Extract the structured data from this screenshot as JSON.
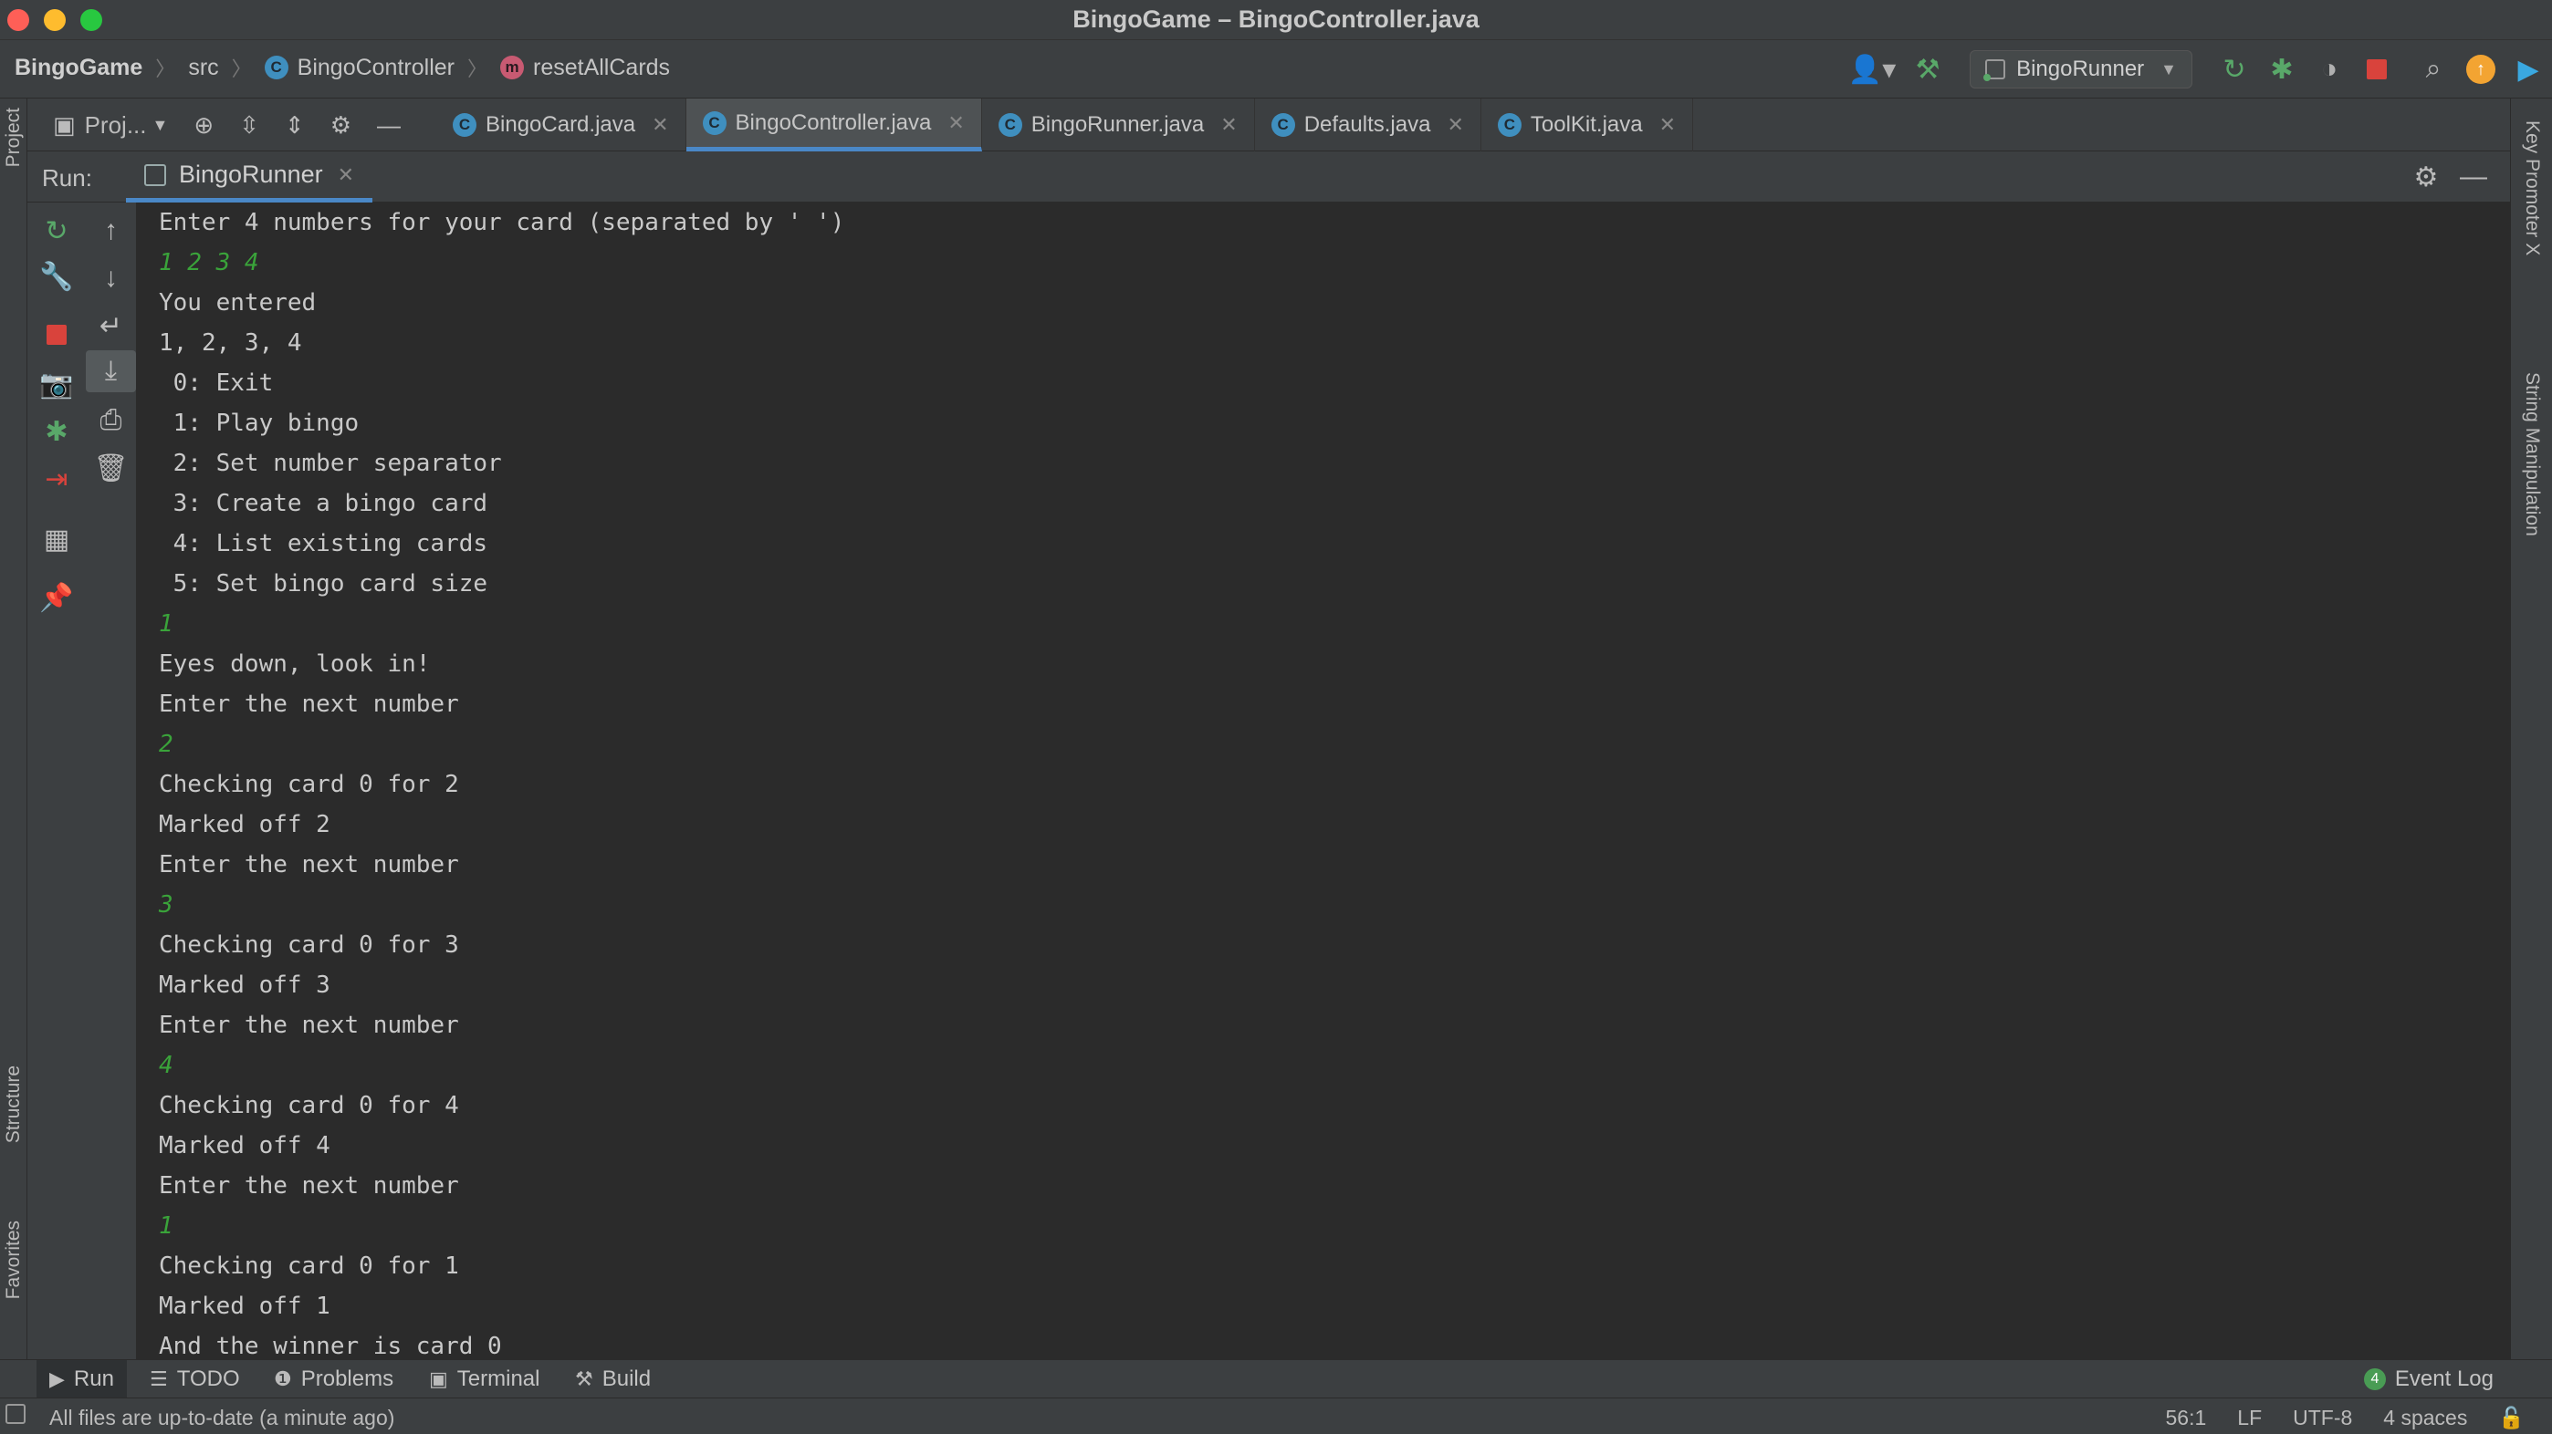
{
  "window": {
    "title": "BingoGame – BingoController.java"
  },
  "breadcrumb": {
    "project": "BingoGame",
    "src": "src",
    "class": "BingoController",
    "method": "resetAllCards"
  },
  "run_config": {
    "name": "BingoRunner"
  },
  "project_panel": {
    "label": "Proj..."
  },
  "editor_tabs": [
    {
      "label": "BingoCard.java"
    },
    {
      "label": "BingoController.java"
    },
    {
      "label": "BingoRunner.java"
    },
    {
      "label": "Defaults.java"
    },
    {
      "label": "ToolKit.java"
    }
  ],
  "run_panel": {
    "label": "Run:",
    "tab": "BingoRunner"
  },
  "console": {
    "lines": [
      {
        "text": "Enter 4 numbers for your card (separated by ' ')",
        "kind": "out"
      },
      {
        "text": "1 2 3 4",
        "kind": "in"
      },
      {
        "text": "You entered",
        "kind": "out"
      },
      {
        "text": "1, 2, 3, 4",
        "kind": "out"
      },
      {
        "text": " 0: Exit",
        "kind": "out"
      },
      {
        "text": " 1: Play bingo",
        "kind": "out"
      },
      {
        "text": " 2: Set number separator",
        "kind": "out"
      },
      {
        "text": " 3: Create a bingo card",
        "kind": "out"
      },
      {
        "text": " 4: List existing cards",
        "kind": "out"
      },
      {
        "text": " 5: Set bingo card size",
        "kind": "out"
      },
      {
        "text": "1",
        "kind": "in"
      },
      {
        "text": "Eyes down, look in!",
        "kind": "out"
      },
      {
        "text": "Enter the next number",
        "kind": "out"
      },
      {
        "text": "2",
        "kind": "in"
      },
      {
        "text": "Checking card 0 for 2",
        "kind": "out"
      },
      {
        "text": "Marked off 2",
        "kind": "out"
      },
      {
        "text": "Enter the next number",
        "kind": "out"
      },
      {
        "text": "3",
        "kind": "in"
      },
      {
        "text": "Checking card 0 for 3",
        "kind": "out"
      },
      {
        "text": "Marked off 3",
        "kind": "out"
      },
      {
        "text": "Enter the next number",
        "kind": "out"
      },
      {
        "text": "4",
        "kind": "in"
      },
      {
        "text": "Checking card 0 for 4",
        "kind": "out"
      },
      {
        "text": "Marked off 4",
        "kind": "out"
      },
      {
        "text": "Enter the next number",
        "kind": "out"
      },
      {
        "text": "1",
        "kind": "in"
      },
      {
        "text": "Checking card 0 for 1",
        "kind": "out"
      },
      {
        "text": "Marked off 1",
        "kind": "out"
      },
      {
        "text": "And the winner is card 0",
        "kind": "out"
      }
    ]
  },
  "left_stripe": {
    "project": "Project",
    "structure": "Structure",
    "favorites": "Favorites"
  },
  "right_stripe": {
    "key_promoter": "Key Promoter X",
    "string_manipulation": "String Manipulation"
  },
  "bottom_tabs": {
    "run": "Run",
    "todo": "TODO",
    "problems": "Problems",
    "terminal": "Terminal",
    "build": "Build",
    "event_log": "Event Log",
    "event_count": "4"
  },
  "status": {
    "message": "All files are up-to-date (a minute ago)",
    "position": "56:1",
    "line_sep": "LF",
    "encoding": "UTF-8",
    "indent": "4 spaces"
  },
  "colors": {
    "accent": "#4a88c7",
    "console_input": "#3aa33a",
    "stop": "#d9433c",
    "run": "#59a869"
  }
}
